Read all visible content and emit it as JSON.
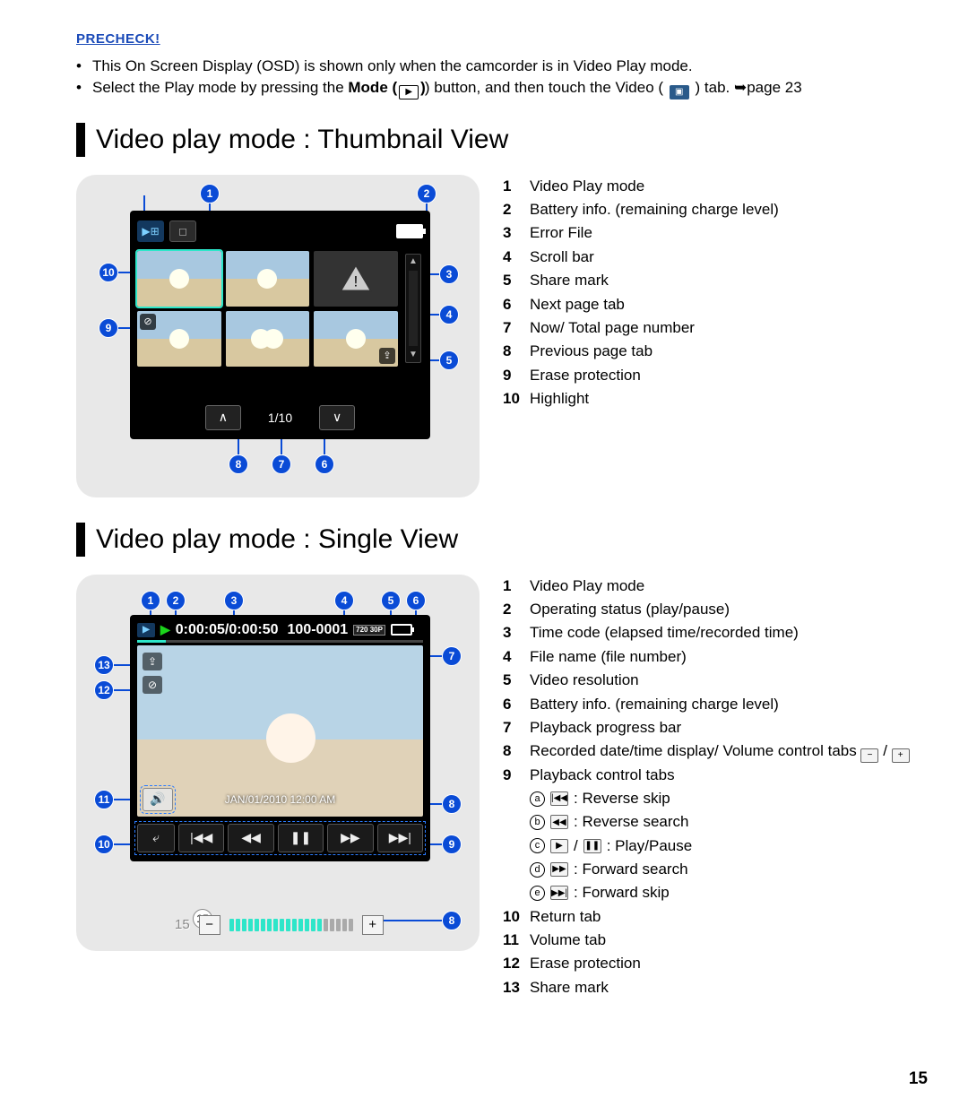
{
  "precheck": "PRECHECK!",
  "instructions": [
    "This On Screen Display (OSD) is shown only when the camcorder is in Video Play mode.",
    "Select the Play mode by pressing the Mode (▶) button, and then touch the Video ( ▣ ) tab. ➥page 23"
  ],
  "inst2_prefix": "Select the Play mode by pressing the ",
  "inst2_mode_label": "Mode (",
  "inst2_mid": ") button, and then touch the Video ( ",
  "inst2_suffix": " ) tab. ➥page 23",
  "section1_title": "Video play mode : Thumbnail View",
  "section2_title": "Video play mode : Single View",
  "thumb_page_counter": "1/10",
  "legend_thumb": [
    {
      "n": "1",
      "t": "Video Play mode"
    },
    {
      "n": "2",
      "t": "Battery info. (remaining charge level)"
    },
    {
      "n": "3",
      "t": "Error File"
    },
    {
      "n": "4",
      "t": "Scroll bar"
    },
    {
      "n": "5",
      "t": "Share mark"
    },
    {
      "n": "6",
      "t": "Next page tab"
    },
    {
      "n": "7",
      "t": "Now/ Total page number"
    },
    {
      "n": "8",
      "t": "Previous page tab"
    },
    {
      "n": "9",
      "t": "Erase protection"
    },
    {
      "n": "10",
      "t": "Highlight"
    }
  ],
  "single": {
    "timecode": "0:00:05/0:00:50",
    "filename": "100-0001",
    "resolution": "720 30P",
    "datetime": "JAN/01/2010 12:00 AM",
    "volume_level": "15"
  },
  "legend_single": [
    {
      "n": "1",
      "t": "Video Play mode"
    },
    {
      "n": "2",
      "t": "Operating status (play/pause)"
    },
    {
      "n": "3",
      "t": "Time code (elapsed time/recorded time)"
    },
    {
      "n": "4",
      "t": "File name (file number)"
    },
    {
      "n": "5",
      "t": "Video resolution"
    },
    {
      "n": "6",
      "t": "Battery info. (remaining charge level)"
    },
    {
      "n": "7",
      "t": "Playback progress bar"
    },
    {
      "n": "8",
      "t": "Recorded date/time display/ Volume control tabs"
    },
    {
      "n": "9",
      "t": "Playback control tabs"
    },
    {
      "n": "10",
      "t": "Return tab"
    },
    {
      "n": "11",
      "t": "Volume tab"
    },
    {
      "n": "12",
      "t": "Erase protection"
    },
    {
      "n": "13",
      "t": "Share mark"
    }
  ],
  "playback_sub": [
    {
      "l": "a",
      "t": ": Reverse skip",
      "g": "|◀◀"
    },
    {
      "l": "b",
      "t": ": Reverse search",
      "g": "◀◀"
    },
    {
      "l": "c",
      "t": ": Play/Pause",
      "g": "▶ / ❚❚"
    },
    {
      "l": "d",
      "t": ": Forward search",
      "g": "▶▶"
    },
    {
      "l": "e",
      "t": ": Forward skip",
      "g": "▶▶|"
    }
  ],
  "vol_minus": "−",
  "vol_plus": "+",
  "vol_slash": "/",
  "page_number": "15"
}
